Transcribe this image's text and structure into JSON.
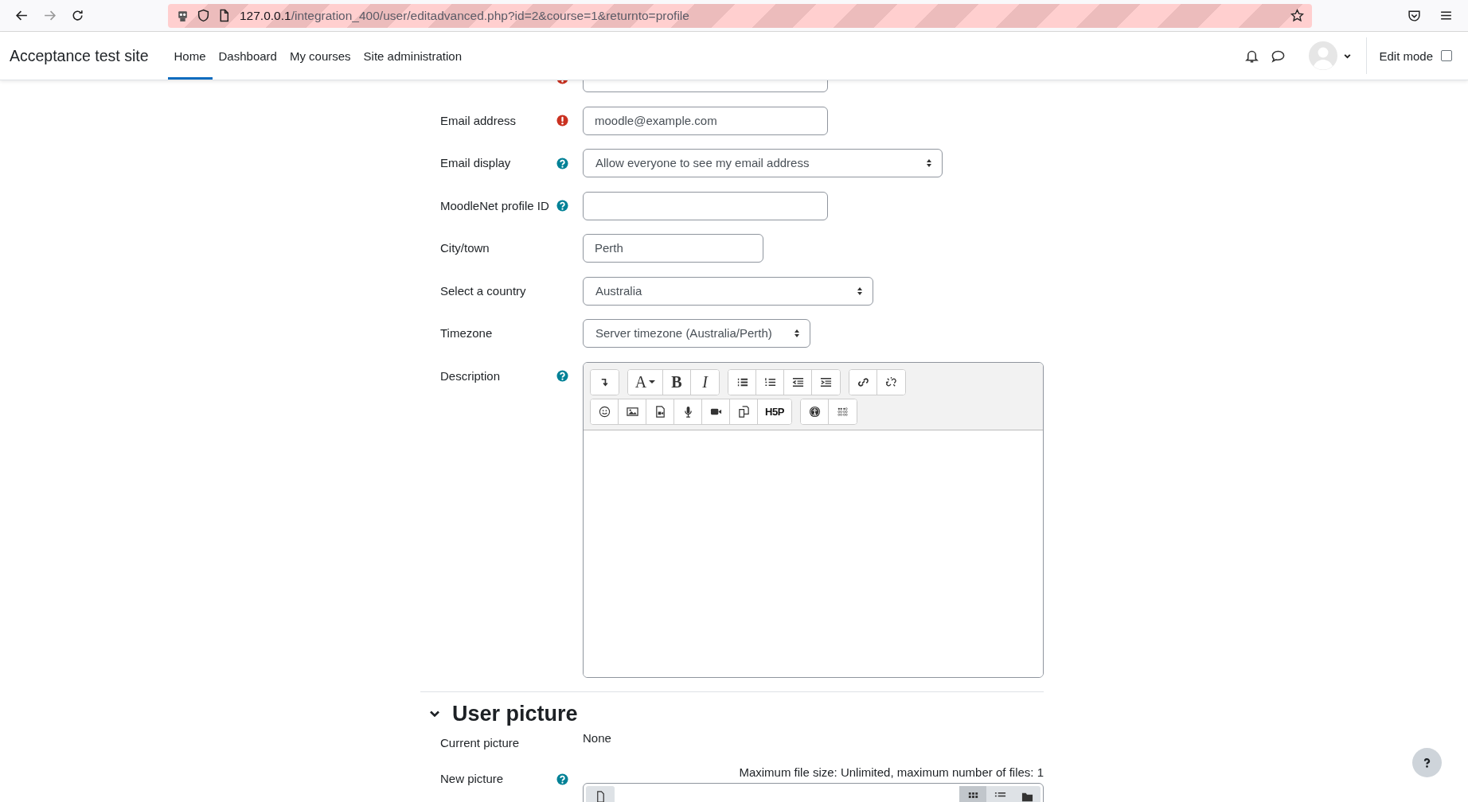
{
  "browser": {
    "url_host": "127.0.0.1",
    "url_path": "/integration_400/user/editadvanced.php?id=2&course=1&returnto=profile"
  },
  "navbar": {
    "site_name": "Acceptance test site",
    "items": [
      {
        "label": "Home",
        "selected": true
      },
      {
        "label": "Dashboard",
        "selected": false
      },
      {
        "label": "My courses",
        "selected": false
      },
      {
        "label": "Site administration",
        "selected": false
      }
    ],
    "edit_mode": {
      "label": "Edit mode",
      "checked": false
    }
  },
  "form": {
    "fields": [
      {
        "required": true,
        "kind": "text"
      },
      {
        "label": "Email address",
        "required": true,
        "kind": "text",
        "value": "moodle@example.com"
      },
      {
        "label": "Email display",
        "help": true,
        "kind": "select",
        "value": "Allow everyone to see my email address"
      },
      {
        "label": "MoodleNet profile ID",
        "help": true,
        "kind": "text"
      },
      {
        "label": "City/town",
        "kind": "text",
        "value": "Perth"
      },
      {
        "label": "Select a country",
        "kind": "select",
        "value": "Australia"
      },
      {
        "label": "Timezone",
        "kind": "select",
        "value": "Server timezone (Australia/Perth)"
      },
      {
        "label": "Description",
        "help": true,
        "kind": "editor"
      }
    ]
  },
  "editor": {
    "toolbar": [
      [
        [
          {
            "kind": "collapse"
          }
        ],
        [
          {
            "kind": "font",
            "glyph": "A"
          },
          {
            "kind": "bold",
            "glyph": "B"
          },
          {
            "kind": "italic",
            "glyph": "I"
          }
        ],
        [
          {
            "kind": "bullets"
          },
          {
            "kind": "numbers"
          },
          {
            "kind": "outdent"
          },
          {
            "kind": "indent"
          }
        ],
        [
          {
            "kind": "link"
          },
          {
            "kind": "unlink"
          }
        ]
      ],
      [
        [
          {
            "kind": "emoji"
          },
          {
            "kind": "image"
          },
          {
            "kind": "media"
          },
          {
            "kind": "mic"
          },
          {
            "kind": "video"
          },
          {
            "kind": "copy"
          },
          {
            "kind": "h5p",
            "glyph": "H5P"
          }
        ],
        [
          {
            "kind": "accessibility"
          },
          {
            "kind": "braille"
          }
        ]
      ]
    ]
  },
  "user_picture": {
    "heading": "User picture",
    "expanded": true,
    "current_label": "Current picture",
    "current_value": "None",
    "new_label": "New picture",
    "new_help": true,
    "limits": "Maximum file size: Unlimited, maximum number of files: 1"
  }
}
